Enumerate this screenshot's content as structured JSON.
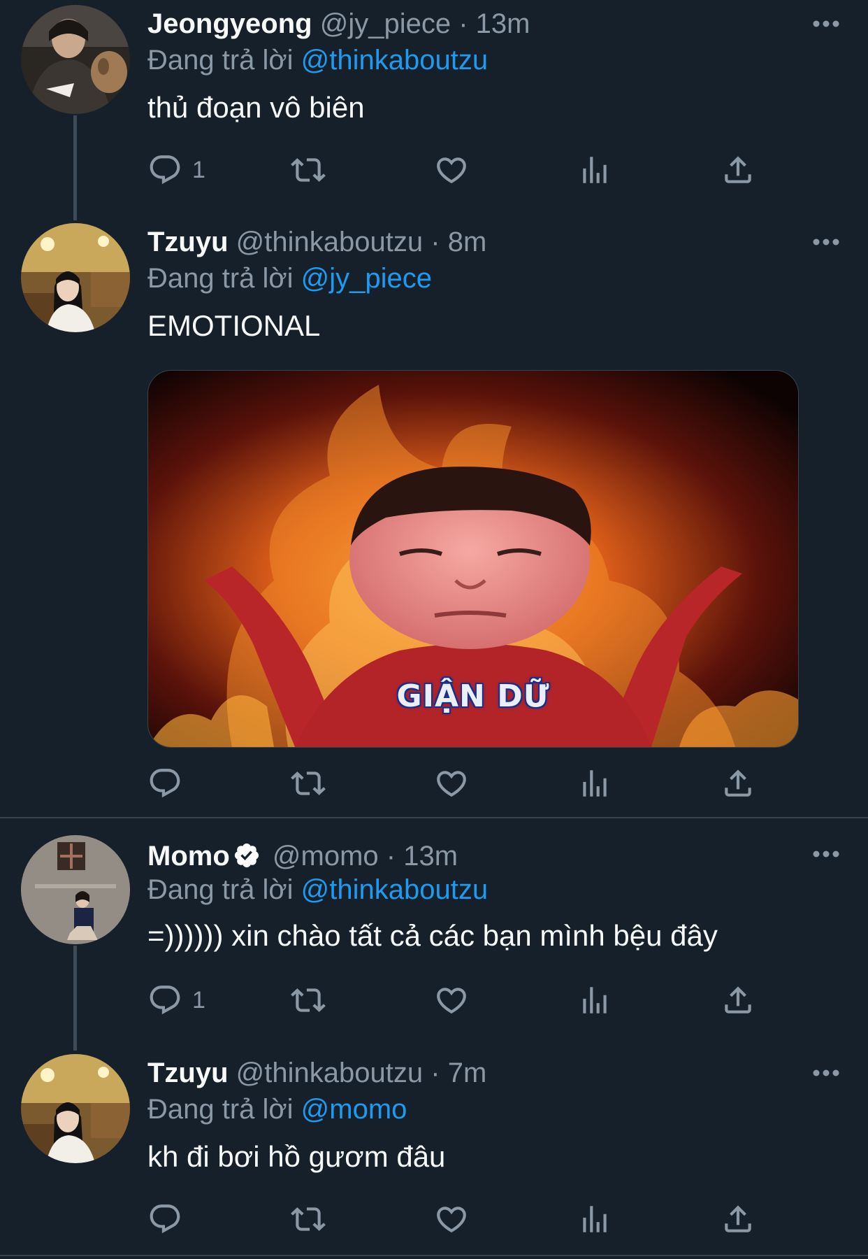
{
  "colors": {
    "background": "#15202b",
    "text_primary": "#f7f9f9",
    "text_secondary": "#8b98a5",
    "mention": "#1d9bf0",
    "verified": "#ffffff"
  },
  "tweets": [
    {
      "name": "Jeongyeong",
      "handle": "@jy_piece",
      "dot": "·",
      "time": "13m",
      "reply_prefix": "Đang trả lời",
      "reply_to": "@thinkaboutzu",
      "text": "thủ đoạn vô biên",
      "reply_count": "1",
      "avatar": "profile-photo-with-dog",
      "verified": false
    },
    {
      "name": "Tzuyu",
      "handle": "@thinkaboutzu",
      "dot": "·",
      "time": "8m",
      "reply_prefix": "Đang trả lời",
      "reply_to": "@jy_piece",
      "text": "EMOTIONAL",
      "reply_count": "",
      "avatar": "profile-photo-woman",
      "verified": false,
      "media": {
        "caption": "GIẬN DỮ",
        "icon": "angry-face-fire-meme"
      }
    },
    {
      "name": "Momo",
      "handle": "@momo",
      "dot": "·",
      "time": "13m",
      "reply_prefix": "Đang trả lời",
      "reply_to": "@thinkaboutzu",
      "text": "=)))))) xin chào tất cả các bạn mình bệu đây",
      "reply_count": "1",
      "avatar": "profile-photo-woman-stone-wall",
      "verified": true
    },
    {
      "name": "Tzuyu",
      "handle": "@thinkaboutzu",
      "dot": "·",
      "time": "7m",
      "reply_prefix": "Đang trả lời",
      "reply_to": "@momo",
      "text": "kh đi bơi hồ gươm đâu",
      "reply_count": "",
      "avatar": "profile-photo-woman",
      "verified": false
    }
  ],
  "action_icons": [
    "reply-icon",
    "retweet-icon",
    "like-icon",
    "views-icon",
    "share-icon"
  ]
}
